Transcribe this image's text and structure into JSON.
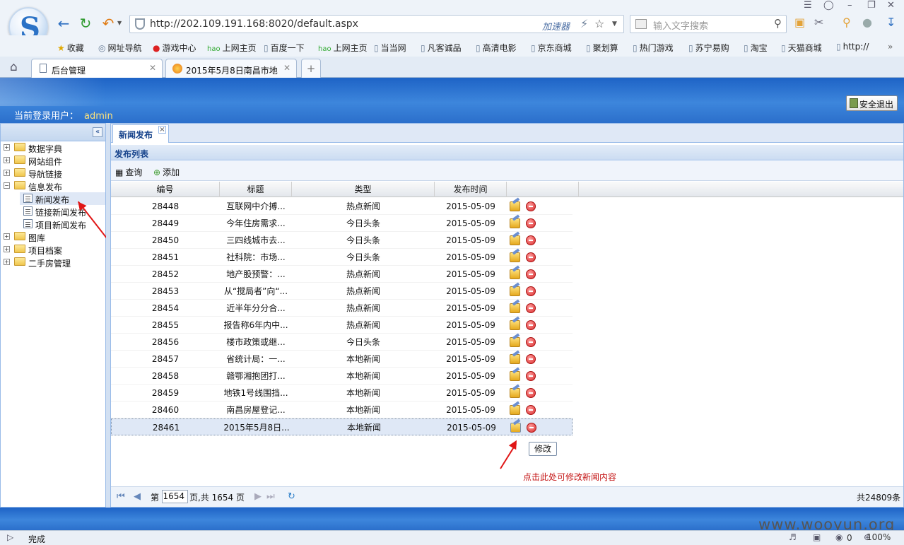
{
  "browser": {
    "url": "http://202.109.191.168:8020/default.aspx",
    "accelerator": "加速器",
    "search_placeholder": "输入文字搜索",
    "bookmarks": [
      "收藏",
      "网址导航",
      "游戏中心",
      "上网主页",
      "百度一下",
      "上网主页",
      "当当网",
      "凡客诚品",
      "高清电影",
      "京东商城",
      "聚划算",
      "热门游戏",
      "苏宁易购",
      "淘宝",
      "天猫商城",
      "http://"
    ],
    "tabs": [
      {
        "label": "后台管理"
      },
      {
        "label": "2015年5月8日南昌市地..."
      }
    ],
    "status": "完成",
    "zoom": "100%",
    "status_count": "0"
  },
  "app": {
    "current_user_label": "当前登录用户：",
    "current_user": "admin",
    "logout": "安全退出"
  },
  "tree": [
    {
      "label": "数据字典",
      "type": "folder",
      "expanded": false
    },
    {
      "label": "网站组件",
      "type": "folder",
      "expanded": false
    },
    {
      "label": "导航链接",
      "type": "folder",
      "expanded": false
    },
    {
      "label": "信息发布",
      "type": "folder",
      "expanded": true
    },
    {
      "label": "新闻发布",
      "type": "page",
      "selected": true
    },
    {
      "label": "链接新闻发布",
      "type": "page"
    },
    {
      "label": "项目新闻发布",
      "type": "page"
    },
    {
      "label": "图库",
      "type": "folder",
      "expanded": false
    },
    {
      "label": "项目档案",
      "type": "folder",
      "expanded": false
    },
    {
      "label": "二手房管理",
      "type": "folder",
      "expanded": false
    }
  ],
  "main": {
    "tab": "新闻发布",
    "list_title": "发布列表",
    "toolbar": {
      "query": "查询",
      "add": "添加"
    },
    "columns": [
      "编号",
      "标题",
      "类型",
      "发布时间"
    ],
    "rows": [
      [
        "28448",
        "互联网中介搏...",
        "热点新闻",
        "2015-05-09"
      ],
      [
        "28449",
        "今年住房需求...",
        "今日头条",
        "2015-05-09"
      ],
      [
        "28450",
        "三四线城市去...",
        "今日头条",
        "2015-05-09"
      ],
      [
        "28451",
        "社科院：市场...",
        "今日头条",
        "2015-05-09"
      ],
      [
        "28452",
        "地产股预警：...",
        "热点新闻",
        "2015-05-09"
      ],
      [
        "28453",
        "从“搅局者”向“...",
        "热点新闻",
        "2015-05-09"
      ],
      [
        "28454",
        "近半年分分合...",
        "热点新闻",
        "2015-05-09"
      ],
      [
        "28455",
        "报告称6年内中...",
        "热点新闻",
        "2015-05-09"
      ],
      [
        "28456",
        "楼市政策或继...",
        "今日头条",
        "2015-05-09"
      ],
      [
        "28457",
        "省统计局：一...",
        "本地新闻",
        "2015-05-09"
      ],
      [
        "28458",
        "赣鄂湘抱团打...",
        "本地新闻",
        "2015-05-09"
      ],
      [
        "28459",
        "地铁1号线围挡...",
        "本地新闻",
        "2015-05-09"
      ],
      [
        "28460",
        "南昌房屋登记...",
        "本地新闻",
        "2015-05-09"
      ],
      [
        "28461",
        "2015年5月8日...",
        "本地新闻",
        "2015-05-09"
      ]
    ],
    "tooltip": "修改",
    "note": "点击此处可修改新闻内容",
    "pager": {
      "page_prefix": "第",
      "page": "1654",
      "page_suffix": "页,共 1654 页",
      "total": "共24809条"
    }
  },
  "watermark": "www.wooyun.org"
}
